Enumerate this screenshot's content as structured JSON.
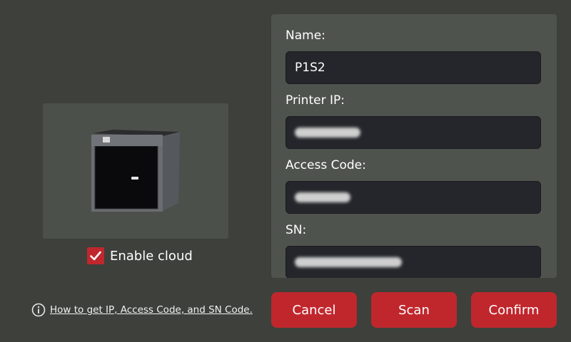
{
  "form": {
    "name": {
      "label": "Name:",
      "value": "P1S2"
    },
    "ip": {
      "label": "Printer IP:"
    },
    "access_code": {
      "label": "Access Code:"
    },
    "sn": {
      "label": "SN:"
    }
  },
  "cloud": {
    "label": "Enable cloud",
    "checked": true
  },
  "help": {
    "link_text": "How to get IP, Access Code, and SN Code.",
    "icon": "info-icon"
  },
  "buttons": {
    "cancel": "Cancel",
    "scan": "Scan",
    "confirm": "Confirm"
  },
  "colors": {
    "background": "#3d403b",
    "panel": "#4f534e",
    "field": "#25262b",
    "accent": "#c0272d"
  }
}
